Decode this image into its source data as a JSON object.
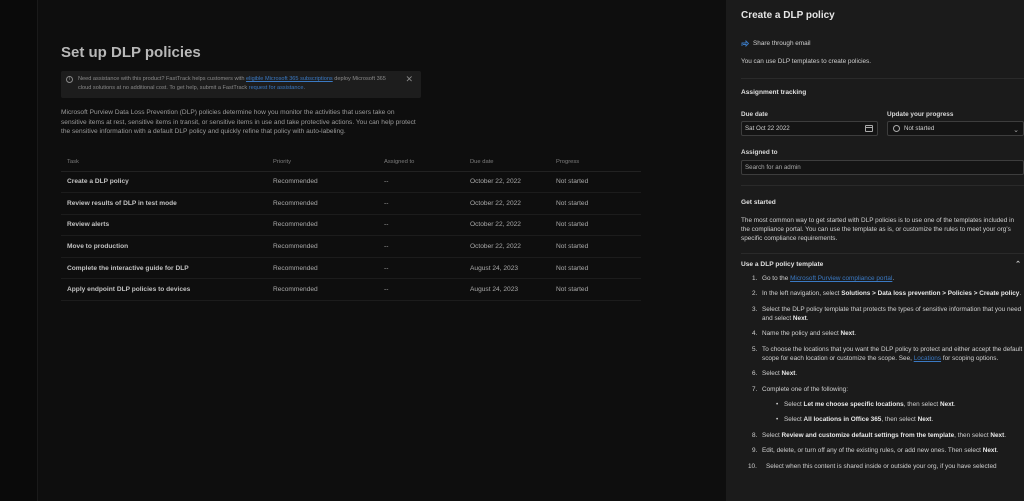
{
  "main": {
    "title": "Set up DLP policies",
    "banner": {
      "text_1": "Need assistance with this product? FastTrack helps customers with ",
      "link_1": "eligible Microsoft 365 subscriptions",
      "text_2": " deploy Microsoft 365 cloud solutions at no additional cost. To get help, submit a FastTrack ",
      "link_2": "request for assistance",
      "text_3": ".",
      "close": "✕"
    },
    "description": "Microsoft Purview Data Loss Prevention (DLP) policies determine how you monitor the activities that users take on sensitive items at rest, sensitive items in transit, or sensitive items in use and take protective actions. You can help protect the sensitive information with a default DLP policy and quickly refine that policy with auto-labeling.",
    "table": {
      "headers": [
        "Task",
        "Priority",
        "Assigned to",
        "Due date",
        "Progress"
      ],
      "rows": [
        [
          "Create a DLP policy",
          "Recommended",
          "--",
          "October 22, 2022",
          "Not started"
        ],
        [
          "Review results of DLP in test mode",
          "Recommended",
          "--",
          "October 22, 2022",
          "Not started"
        ],
        [
          "Review alerts",
          "Recommended",
          "--",
          "October 22, 2022",
          "Not started"
        ],
        [
          "Move to production",
          "Recommended",
          "--",
          "October 22, 2022",
          "Not started"
        ],
        [
          "Complete the interactive guide for DLP",
          "Recommended",
          "--",
          "August 24, 2023",
          "Not started"
        ],
        [
          "Apply endpoint DLP policies to devices",
          "Recommended",
          "--",
          "August 24, 2023",
          "Not started"
        ]
      ]
    }
  },
  "panel": {
    "title": "Create a DLP policy",
    "share_label": "Share through email",
    "intro": "You can use DLP templates to create policies.",
    "assignment_heading": "Assignment tracking",
    "due_date_label": "Due date",
    "due_date_value": "Sat Oct 22 2022",
    "progress_label": "Update your progress",
    "progress_value": "Not started",
    "assigned_label": "Assigned to",
    "assigned_placeholder": "Search for an admin",
    "get_started_heading": "Get started",
    "get_started_text": "The most common way to get started with DLP policies is to use one of the templates included in the compliance portal. You can use the template as is, or customize the rules to meet your org's specific compliance requirements.",
    "template_section": "Use a DLP policy template",
    "steps": {
      "s1_a": "Go to the ",
      "s1_link": "Microsoft Purview compliance portal",
      "s1_b": ".",
      "s2_a": "In the left navigation, select ",
      "s2_b": "Solutions > Data loss prevention > Policies > Create policy",
      "s2_c": ".",
      "s3_a": "Select the DLP policy template that protects the types of sensitive information that you need and select ",
      "s3_b": "Next",
      "s3_c": ".",
      "s4_a": "Name the policy and select ",
      "s4_b": "Next",
      "s4_c": ".",
      "s5_a": "To choose the locations that you want the DLP policy to protect and either accept the default scope for each location or customize the scope. See, ",
      "s5_link": "Locations",
      "s5_b": " for scoping options.",
      "s6_a": "Select ",
      "s6_b": "Next",
      "s6_c": ".",
      "s7": "Complete one of the following:",
      "s7_1a": "Select ",
      "s7_1b": "Let me choose specific locations",
      "s7_1c": ", then select ",
      "s7_1d": "Next",
      "s7_1e": ".",
      "s7_2a": "Select ",
      "s7_2b": "All locations in Office 365",
      "s7_2c": ", then select ",
      "s7_2d": "Next",
      "s7_2e": ".",
      "s8_a": "Select ",
      "s8_b": "Review and customize default settings from the template",
      "s8_c": ", then select ",
      "s8_d": "Next",
      "s8_e": ".",
      "s9_a": "Edit, delete, or turn off any of the existing rules, or add new ones. Then select ",
      "s9_b": "Next",
      "s9_c": ".",
      "s10": "Select when this content is shared inside or outside your org, if you have selected"
    }
  }
}
